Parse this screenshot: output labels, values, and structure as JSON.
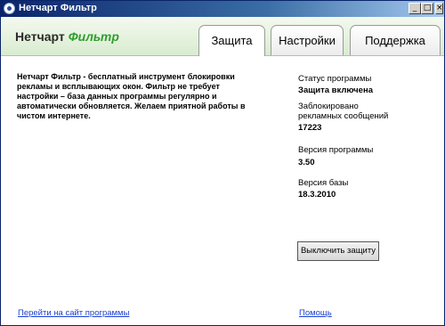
{
  "window": {
    "title": "Нетчарт Фильтр",
    "minimize": "_",
    "maximize": "□",
    "close": "×"
  },
  "header": {
    "brand_main": "Нетчарт",
    "brand_accent": "Фильтр"
  },
  "tabs": [
    {
      "label": "Защита"
    },
    {
      "label": "Настройки"
    },
    {
      "label": "Поддержка"
    }
  ],
  "main": {
    "description": "Нетчарт Фильтр - бесплатный инструмент блокировки рекламы и всплывающих окон. Фильтр не требует настройки – база данных программы регулярно и автоматически обновляется. Желаем приятной работы в чистом интернете."
  },
  "status": {
    "status_label": "Статус программы",
    "status_value": "Защита включена",
    "blocked_label_1": "Заблокировано",
    "blocked_label_2": "рекламных сообщений",
    "blocked_value": "17223",
    "version_label": "Версия программы",
    "version_value": "3.50",
    "db_label": "Версия базы",
    "db_value": "18.3.2010",
    "toggle_button": "Выключить защиту"
  },
  "footer": {
    "site_link": "Перейти на сайт программы",
    "help_link": "Помощь"
  }
}
